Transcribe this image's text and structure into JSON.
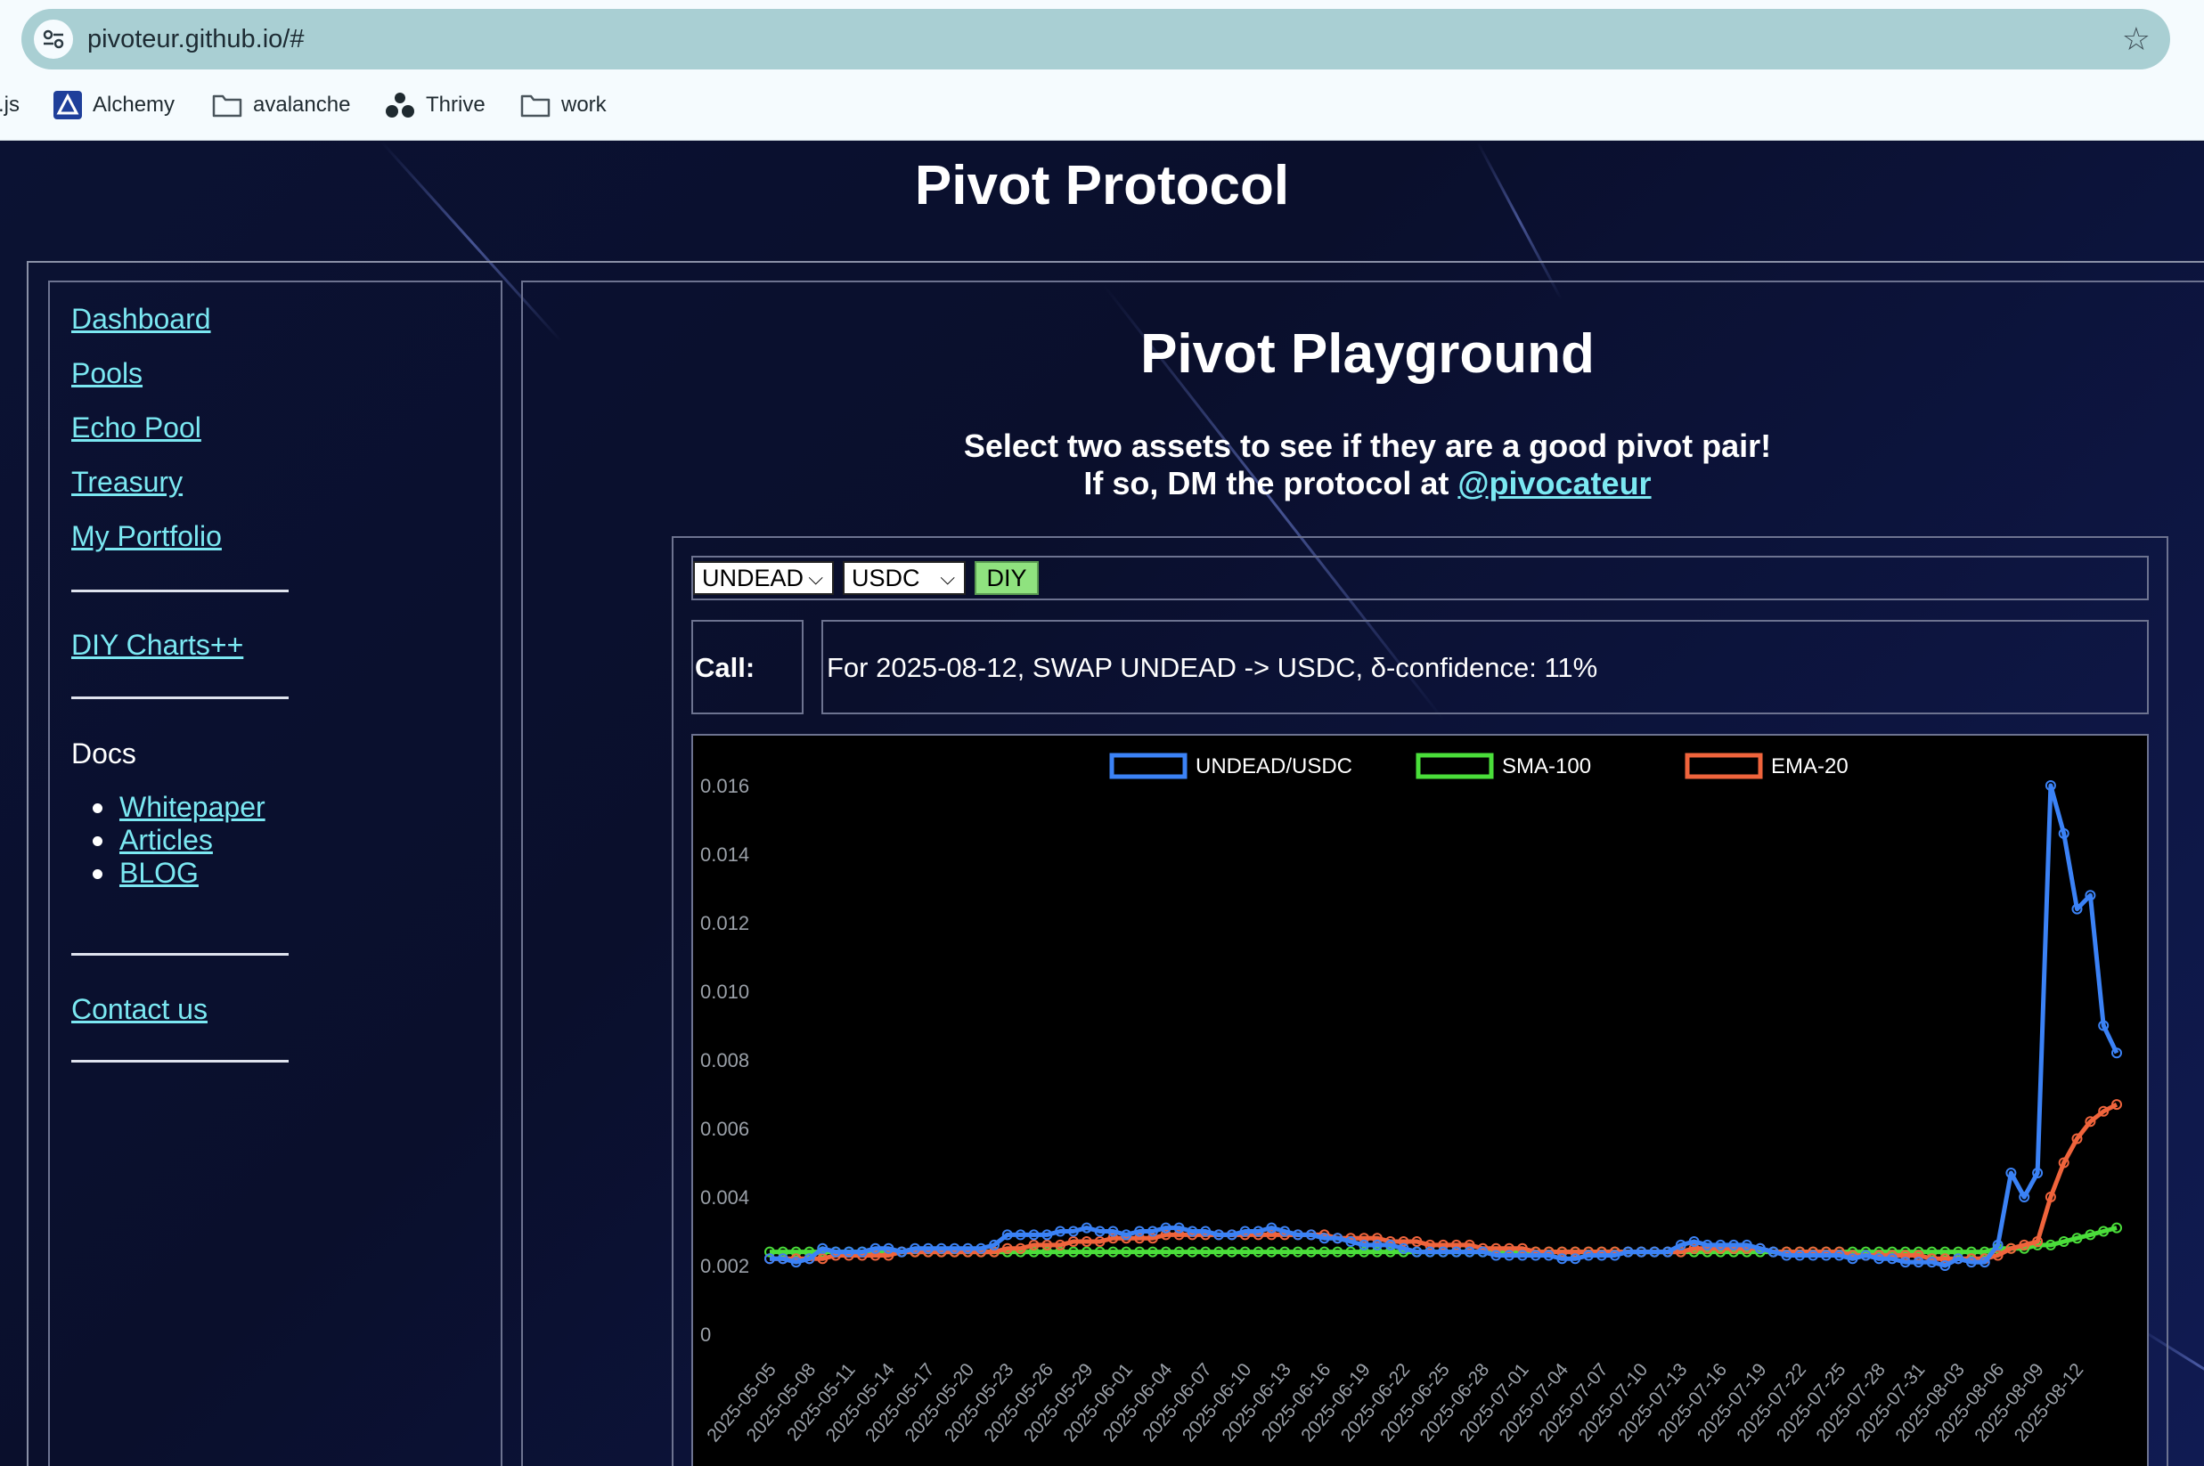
{
  "browser": {
    "url": "pivoteur.github.io/#",
    "bookmarks": [
      {
        "label": ".js",
        "icon": "none"
      },
      {
        "label": "Alchemy",
        "icon": "alchemy-logo-icon"
      },
      {
        "label": "avalanche",
        "icon": "folder-icon"
      },
      {
        "label": "Thrive",
        "icon": "thrive-logo-icon"
      },
      {
        "label": "work",
        "icon": "folder-icon"
      }
    ]
  },
  "site": {
    "title": "Pivot Protocol"
  },
  "sidebar": {
    "links": [
      "Dashboard",
      "Pools",
      "Echo Pool",
      "Treasury",
      "My Portfolio"
    ],
    "diy": "DIY Charts++",
    "docs_label": "Docs",
    "docs_items": [
      "Whitepaper",
      "Articles",
      "BLOG"
    ],
    "contact": "Contact us"
  },
  "main": {
    "title": "Pivot Playground",
    "subtitle_line1": "Select two assets to see if they are a good pivot pair!",
    "subtitle_line2_prefix": "If so, DM the protocol at ",
    "handle": "@pivocateur",
    "controls": {
      "asset1": "UNDEAD",
      "asset2": "USDC",
      "diy_button": "DIY"
    },
    "call": {
      "label": "Call:",
      "text": "For 2025-08-12, SWAP UNDEAD -> USDC, δ-confidence: 11%"
    }
  },
  "chart_data": {
    "type": "line",
    "ylim": [
      0,
      0.016
    ],
    "yticks": [
      "0",
      "0.002",
      "0.004",
      "0.006",
      "0.008",
      "0.010",
      "0.012",
      "0.014",
      "0.016"
    ],
    "xtick_labels": [
      "2025-05-05",
      "2025-05-08",
      "2025-05-11",
      "2025-05-14",
      "2025-05-17",
      "2025-05-20",
      "2025-05-23",
      "2025-05-26",
      "2025-05-29",
      "2025-06-01",
      "2025-06-04",
      "2025-06-07",
      "2025-06-10",
      "2025-06-13",
      "2025-06-16",
      "2025-06-19",
      "2025-06-22",
      "2025-06-25",
      "2025-06-28",
      "2025-07-01",
      "2025-07-04",
      "2025-07-07",
      "2025-07-10",
      "2025-07-13",
      "2025-07-16",
      "2025-07-19",
      "2025-07-22",
      "2025-07-25",
      "2025-07-28",
      "2025-07-31",
      "2025-08-03",
      "2025-08-06",
      "2025-08-09",
      "2025-08-12"
    ],
    "legend_position": "top-center",
    "colors": {
      "pair": "#3b82f6",
      "sma": "#4ade3a",
      "ema": "#f0643c"
    },
    "series": [
      {
        "name": "UNDEAD/USDC",
        "color": "#3b82f6",
        "values": [
          0.0022,
          0.0022,
          0.0021,
          0.0022,
          0.0025,
          0.0024,
          0.0024,
          0.0024,
          0.0025,
          0.0025,
          0.0024,
          0.0025,
          0.0025,
          0.0025,
          0.0025,
          0.0025,
          0.0025,
          0.0026,
          0.0029,
          0.0029,
          0.0029,
          0.0029,
          0.003,
          0.003,
          0.0031,
          0.003,
          0.003,
          0.0029,
          0.003,
          0.003,
          0.0031,
          0.0031,
          0.003,
          0.003,
          0.0029,
          0.0029,
          0.003,
          0.003,
          0.0031,
          0.003,
          0.0029,
          0.0029,
          0.0028,
          0.0028,
          0.0027,
          0.0026,
          0.0026,
          0.0026,
          0.0025,
          0.0024,
          0.0024,
          0.0024,
          0.0024,
          0.0024,
          0.0024,
          0.0023,
          0.0023,
          0.0023,
          0.0023,
          0.0023,
          0.0022,
          0.0022,
          0.0023,
          0.0023,
          0.0023,
          0.0024,
          0.0024,
          0.0024,
          0.0024,
          0.0026,
          0.0027,
          0.0026,
          0.0026,
          0.0026,
          0.0026,
          0.0025,
          0.0024,
          0.0023,
          0.0023,
          0.0023,
          0.0023,
          0.0023,
          0.0022,
          0.0023,
          0.0022,
          0.0022,
          0.0021,
          0.0021,
          0.0021,
          0.002,
          0.0022,
          0.0021,
          0.0021,
          0.0026,
          0.0047,
          0.004,
          0.0047,
          0.016,
          0.0146,
          0.0124,
          0.0128,
          0.009,
          0.0082
        ]
      },
      {
        "name": "SMA-100",
        "color": "#4ade3a",
        "values": [
          0.0024,
          0.0024,
          0.0024,
          0.0024,
          0.0024,
          0.0024,
          0.0024,
          0.0024,
          0.0024,
          0.0024,
          0.0024,
          0.0024,
          0.0024,
          0.0024,
          0.0024,
          0.0024,
          0.0024,
          0.0024,
          0.0024,
          0.0024,
          0.0024,
          0.0024,
          0.0024,
          0.0024,
          0.0024,
          0.0024,
          0.0024,
          0.0024,
          0.0024,
          0.0024,
          0.0024,
          0.0024,
          0.0024,
          0.0024,
          0.0024,
          0.0024,
          0.0024,
          0.0024,
          0.0024,
          0.0024,
          0.0024,
          0.0024,
          0.0024,
          0.0024,
          0.0024,
          0.0024,
          0.0024,
          0.0024,
          0.0024,
          0.0024,
          0.0024,
          0.0024,
          0.0024,
          0.0024,
          0.0024,
          0.0024,
          0.0024,
          0.0024,
          0.0024,
          0.0024,
          0.0024,
          0.0024,
          0.0024,
          0.0024,
          0.0024,
          0.0024,
          0.0024,
          0.0024,
          0.0024,
          0.0024,
          0.0024,
          0.0024,
          0.0024,
          0.0024,
          0.0024,
          0.0024,
          0.0024,
          0.0024,
          0.0024,
          0.0024,
          0.0024,
          0.0024,
          0.0024,
          0.0024,
          0.0024,
          0.0024,
          0.0024,
          0.0024,
          0.0024,
          0.0024,
          0.0024,
          0.0024,
          0.0024,
          0.0025,
          0.0025,
          0.0025,
          0.0026,
          0.0026,
          0.0027,
          0.0028,
          0.0029,
          0.003,
          0.0031
        ]
      },
      {
        "name": "EMA-20",
        "color": "#f0643c",
        "values": [
          0.0022,
          0.0022,
          0.0022,
          0.0022,
          0.0022,
          0.0023,
          0.0023,
          0.0023,
          0.0023,
          0.0023,
          0.0024,
          0.0024,
          0.0024,
          0.0024,
          0.0024,
          0.0024,
          0.0024,
          0.0024,
          0.0025,
          0.0025,
          0.0026,
          0.0026,
          0.0026,
          0.0027,
          0.0027,
          0.0027,
          0.0028,
          0.0028,
          0.0028,
          0.0028,
          0.0029,
          0.0029,
          0.0029,
          0.0029,
          0.0029,
          0.0029,
          0.0029,
          0.0029,
          0.0029,
          0.0029,
          0.0029,
          0.0029,
          0.0029,
          0.0028,
          0.0028,
          0.0028,
          0.0028,
          0.0027,
          0.0027,
          0.0027,
          0.0026,
          0.0026,
          0.0026,
          0.0026,
          0.0025,
          0.0025,
          0.0025,
          0.0025,
          0.0024,
          0.0024,
          0.0024,
          0.0024,
          0.0024,
          0.0024,
          0.0024,
          0.0024,
          0.0024,
          0.0024,
          0.0024,
          0.0024,
          0.0025,
          0.0025,
          0.0025,
          0.0025,
          0.0025,
          0.0025,
          0.0024,
          0.0024,
          0.0024,
          0.0024,
          0.0024,
          0.0024,
          0.0023,
          0.0023,
          0.0023,
          0.0023,
          0.0023,
          0.0023,
          0.0022,
          0.0022,
          0.0022,
          0.0022,
          0.0022,
          0.0023,
          0.0025,
          0.0026,
          0.0027,
          0.004,
          0.005,
          0.0057,
          0.0062,
          0.0065,
          0.0067
        ]
      }
    ]
  }
}
